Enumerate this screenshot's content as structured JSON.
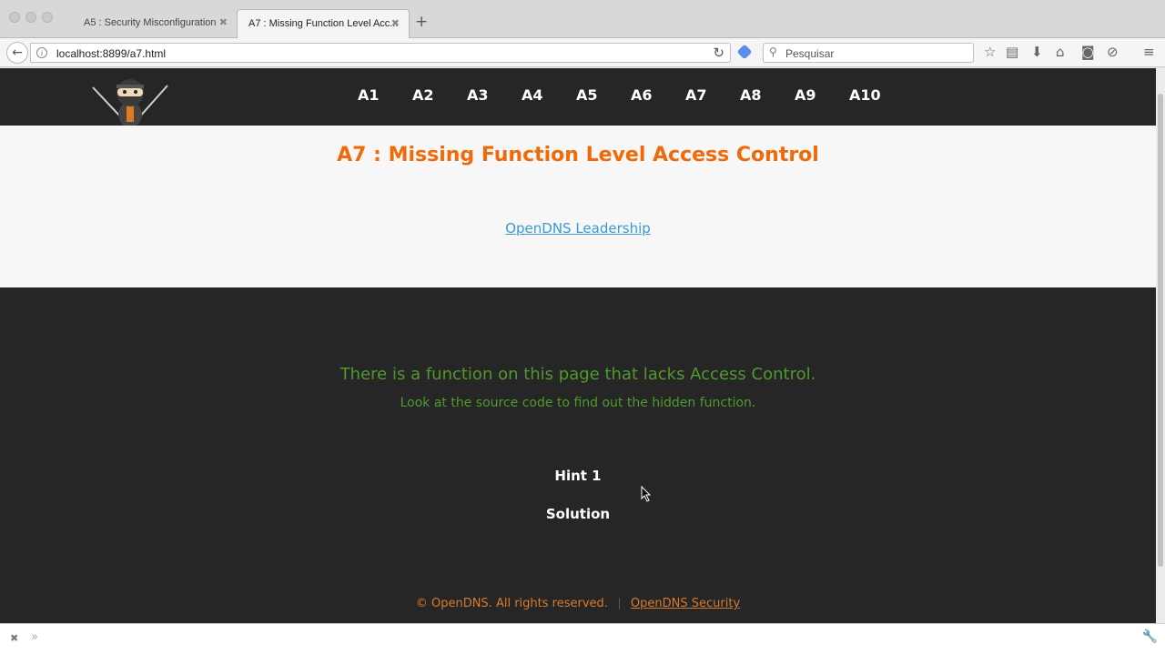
{
  "browser": {
    "tabs": [
      {
        "label": "A5 : Security Misconfiguration",
        "active": false
      },
      {
        "label": "A7 : Missing Function Level Acc...",
        "active": true
      }
    ],
    "new_tab_symbol": "+",
    "close_symbol": "✖",
    "url": "localhost:8899/a7.html",
    "search_placeholder": "Pesquisar",
    "toolbar_icons": [
      "back-icon",
      "info-icon",
      "reload-icon",
      "extension-icon",
      "search-icon",
      "star-icon",
      "reading-list-icon",
      "download-icon",
      "home-icon",
      "pocket-icon",
      "addon-icon",
      "menu-icon"
    ]
  },
  "site": {
    "nav_items": [
      "A1",
      "A2",
      "A3",
      "A4",
      "A5",
      "A6",
      "A7",
      "A8",
      "A9",
      "A10"
    ],
    "title": "A7 : Missing Function Level Access Control",
    "leadership_link": "OpenDNS Leadership",
    "message_main": "There is a function on this page that lacks Access Control.",
    "message_sub": "Look at the source code to find out the hidden function.",
    "hint_label": "Hint 1",
    "solution_label": "Solution",
    "footer_copyright": "© OpenDNS. All rights reserved.",
    "footer_link": "OpenDNS Security"
  },
  "colors": {
    "title_orange": "#f06a0a",
    "link_blue": "#3d9ad1",
    "message_green": "#4f9a2e",
    "footer_orange": "#d97a2c",
    "dark_bg": "#262626"
  }
}
